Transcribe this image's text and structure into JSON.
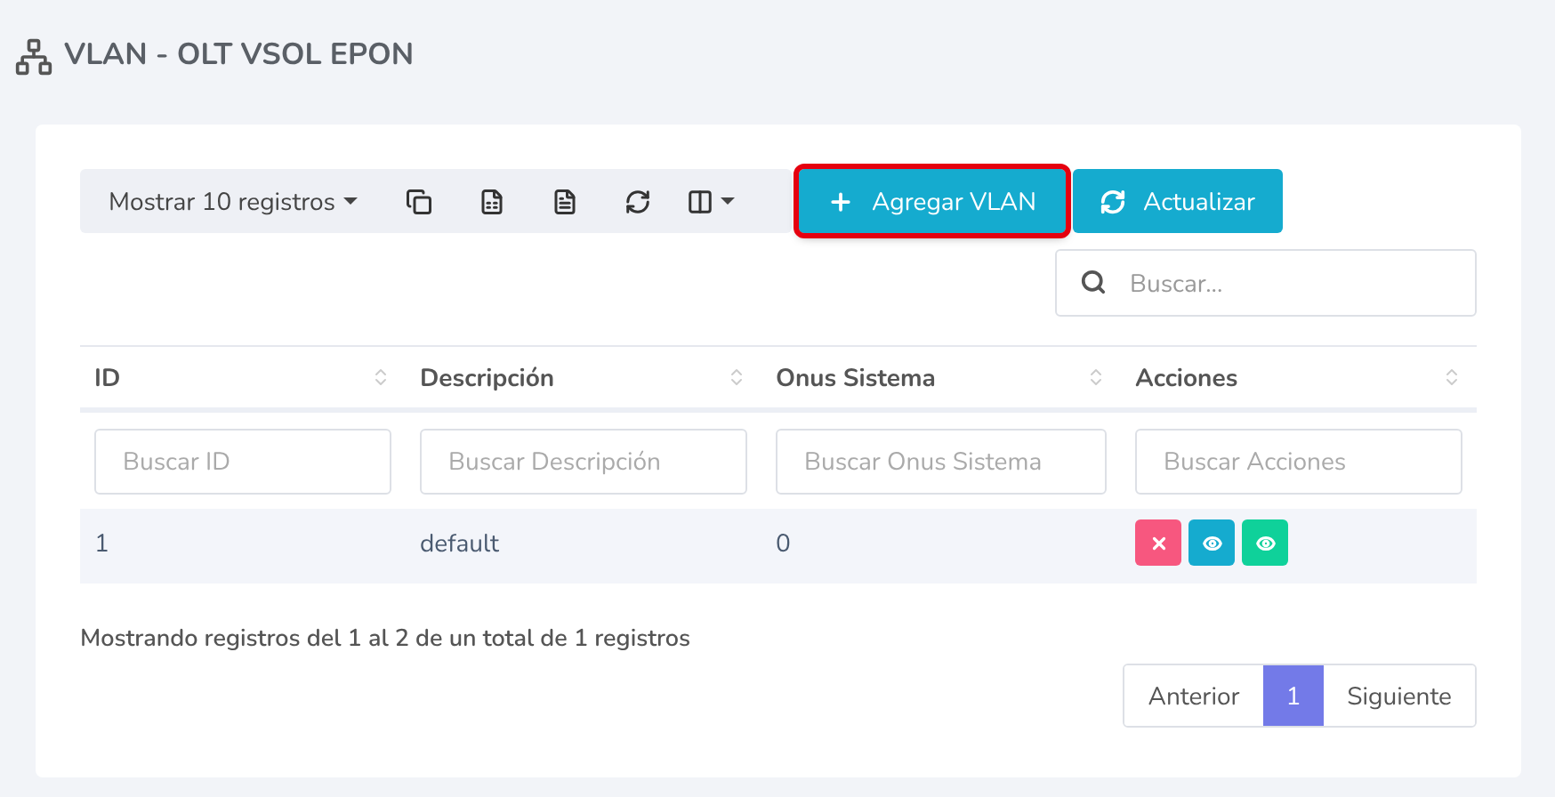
{
  "page_title": "VLAN - OLT VSOL EPON",
  "toolbar": {
    "length_menu": "Mostrar 10 registros",
    "export_buttons": [
      {
        "kind": "copy"
      },
      {
        "kind": "excel"
      },
      {
        "kind": "csv"
      },
      {
        "kind": "reload"
      },
      {
        "kind": "columns"
      }
    ]
  },
  "actions": [
    {
      "label": "Agregar VLAN",
      "kind": "add",
      "highlighted": true
    },
    {
      "label": "Actualizar",
      "kind": "refresh",
      "highlighted": false
    }
  ],
  "search": {
    "placeholder": "Buscar..."
  },
  "table": {
    "columns": [
      {
        "label": "ID",
        "filter_placeholder": "Buscar ID"
      },
      {
        "label": "Descripción",
        "filter_placeholder": "Buscar Descripción"
      },
      {
        "label": "Onus Sistema",
        "filter_placeholder": "Buscar Onus Sistema"
      },
      {
        "label": "Acciones",
        "filter_placeholder": "Buscar Acciones"
      }
    ],
    "rows": [
      {
        "cells": [
          "1",
          "default",
          "0"
        ],
        "row_actions": [
          {
            "kind": "delete",
            "color": "#f7577f"
          },
          {
            "kind": "view",
            "color": "#15abcf"
          },
          {
            "kind": "view",
            "color": "#0fd19a"
          }
        ]
      }
    ]
  },
  "info": "Mostrando registros del 1 al 2 de un total de 1 registros",
  "pagination": [
    {
      "label": "Anterior",
      "selected": false
    },
    {
      "label": "1",
      "selected": true
    },
    {
      "label": "Siguiente",
      "selected": false
    }
  ]
}
